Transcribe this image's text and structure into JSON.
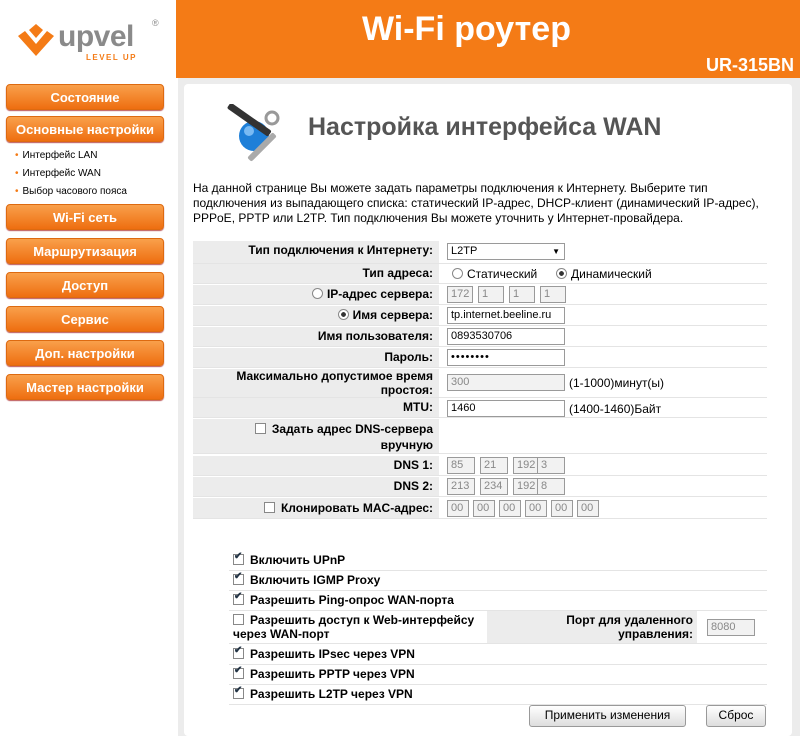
{
  "header": {
    "logo_text": "upvel",
    "logo_reg": "®",
    "logo_tagline": "LEVEL UP",
    "title": "Wi-Fi роутер",
    "model": "UR-315BN"
  },
  "sidebar": {
    "items": [
      {
        "label": "Состояние"
      },
      {
        "label": "Основные настройки"
      },
      {
        "label": "Wi-Fi сеть"
      },
      {
        "label": "Маршрутизация"
      },
      {
        "label": "Доступ"
      },
      {
        "label": "Сервис"
      },
      {
        "label": "Доп. настройки"
      },
      {
        "label": "Мастер настройки"
      }
    ],
    "subitems": [
      "Интерфейс LAN",
      "Интерфейс WAN",
      "Выбор часового пояса"
    ]
  },
  "page": {
    "title": "Настройка интерфейса WAN",
    "intro": "На данной странице Вы можете задать параметры подключения к Интернету. Выберите тип подключения из выпадающего списка: статический IP-адрес, DHCP-клиент (динамический IP-адрес), PPPoE, PPTP или L2TP. Тип подключения Вы можете уточнить у Интернет-провайдера."
  },
  "form": {
    "conn_type_label": "Тип подключения к Интернету:",
    "conn_type_value": "L2TP",
    "addr_type_label": "Тип адреса:",
    "addr_static": "Статический",
    "addr_dynamic": "Динамический",
    "server_ip_label": "IP-адрес сервера:",
    "server_ip": [
      "172",
      "1",
      "1",
      "1"
    ],
    "server_name_label": "Имя сервера:",
    "server_name_value": "tp.internet.beeline.ru",
    "username_label": "Имя пользователя:",
    "username_value": "0893530706",
    "password_label": "Пароль:",
    "password_value": "••••••••",
    "idle_label": "Максимально допустимое время простоя:",
    "idle_value": "300",
    "idle_hint": "(1-1000)минут(ы)",
    "mtu_label": "MTU:",
    "mtu_value": "1460",
    "mtu_hint": "(1400-1460)Байт",
    "dns_manual_label": "Задать адрес DNS-сервера вручную",
    "dns1_label": "DNS 1:",
    "dns1": [
      "85",
      "21",
      "192",
      "3"
    ],
    "dns2_label": "DNS 2:",
    "dns2": [
      "213",
      "234",
      "192",
      "8"
    ],
    "mac_label": "Клонировать MAC-адрес:",
    "mac": [
      "00",
      "00",
      "00",
      "00",
      "00",
      "00"
    ]
  },
  "options": {
    "upnp": "Включить UPnP",
    "igmp": "Включить IGMP Proxy",
    "ping": "Разрешить Ping-опрос WAN-порта",
    "web_access": "Разрешить доступ к Web-интерфейсу через WAN-порт",
    "remote_port_label": "Порт для удаленного управления:",
    "remote_port_value": "8080",
    "ipsec": "Разрешить IPsec через VPN",
    "pptp": "Разрешить PPTP через VPN",
    "l2tp": "Разрешить L2TP через VPN"
  },
  "buttons": {
    "apply": "Применить изменения",
    "reset": "Сброс"
  },
  "colors": {
    "accent": "#f47b16"
  }
}
